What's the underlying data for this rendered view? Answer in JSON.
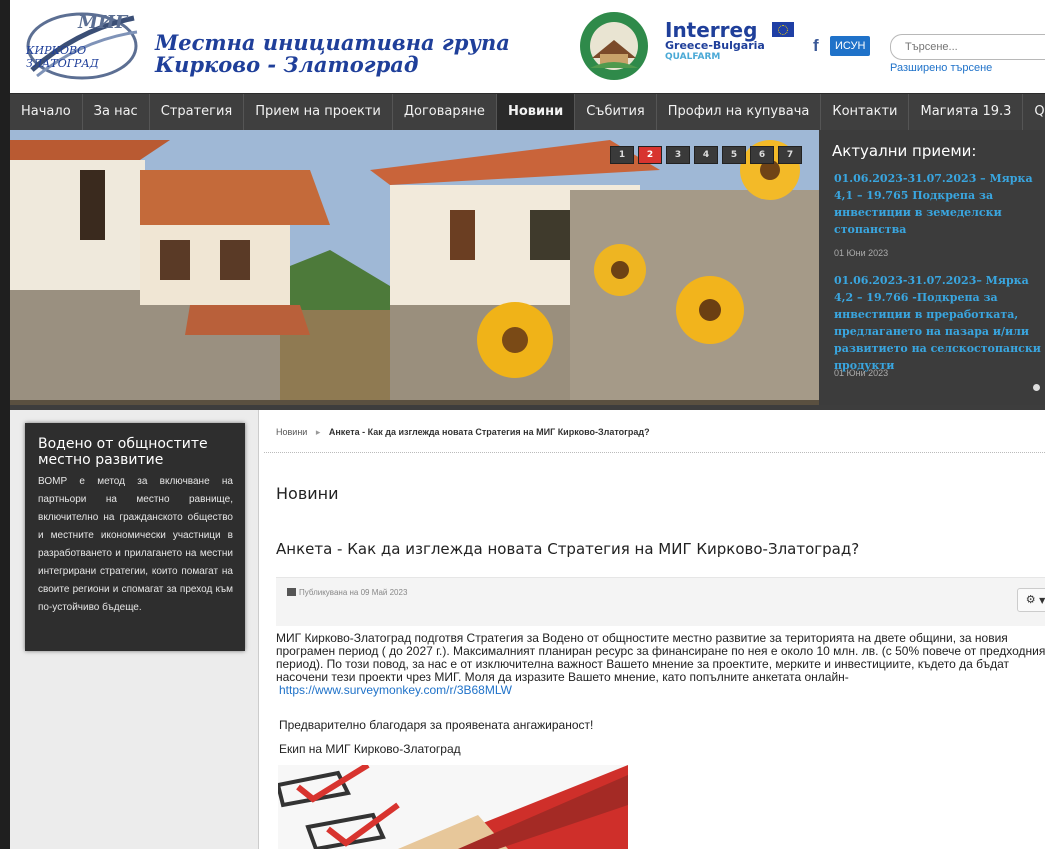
{
  "header": {
    "logo_text_top": "МИГ",
    "logo_text_line1": "КИРКОВО",
    "logo_text_line2": "ЗЛАТОГРАД",
    "site_title_line1": "Местна инициативна група",
    "site_title_line2": "Кирково - Златоград",
    "interreg_brand": "Interreg",
    "interreg_sub1": "Greece-Bulgaria",
    "interreg_sub2": "QUALFARM",
    "facebook_label": "f",
    "isun_label": "ИСУН",
    "search_placeholder": "Търсене...",
    "advanced_search": "Разширено търсене"
  },
  "nav": {
    "items": [
      {
        "label": "Начало"
      },
      {
        "label": "За нас"
      },
      {
        "label": "Стратегия"
      },
      {
        "label": "Прием на проекти"
      },
      {
        "label": "Договаряне"
      },
      {
        "label": "Новини"
      },
      {
        "label": "Събития"
      },
      {
        "label": "Профил на купувача"
      },
      {
        "label": "Контакти"
      },
      {
        "label": "Магията 19.3"
      },
      {
        "label": "QualFarm"
      }
    ],
    "active": "Новини"
  },
  "slider": {
    "pages": [
      "1",
      "2",
      "3",
      "4",
      "5",
      "6",
      "7"
    ],
    "active_page": "2"
  },
  "current_calls": {
    "title": "Актуални приеми:",
    "items": [
      {
        "text": "01.06.2023-31.07.2023 – Мярка 4,1 – 19.765 Подкрепа за инвестиции в земеделски стопанства",
        "date": "01 Юни 2023"
      },
      {
        "text": "01.06.2023-31.07.2023– Мярка 4,2 – 19.766 -Подкрепа за инвестиции в преработката, предлагането на пазара и/или развитието на селскостопански продукти",
        "date": "01 Юни 2023"
      }
    ]
  },
  "info_box": {
    "title": "Водено от общностите местно развитие",
    "text": "ВОМР е метод за включване на партньори на местно равнище, включително на гражданското общество и местните икономически участници в разработването и прилагането на местни интегрирани стратегии, които помагат на своите региони и спомагат за преход към по-устойчиво бъдеще."
  },
  "breadcrumb": {
    "home": "Новини",
    "current": "Анкета - Как да изглежда новата Стратегия на МИГ Кирково-Златоград?"
  },
  "page": {
    "title": "Новини",
    "article_title": "Анкета - Как да изглежда новата Стратегия на МИГ Кирково-Златоград?",
    "published": "Публикувана на 09 Май 2023",
    "body": "МИГ Кирково-Златоград подготвя Стратегия за Водено от общностите местно развитие за територията на двете общини, за новия програмен период ( до 2027 г.). Максималният планиран ресурс за финансиране по нея е около 10 млн. лв. (с 50% повече от предходния период). По този повод, за нас е от изключителна важност Вашето мнение за проектите, мерките и инвестициите, където да бъдат насочени тези проекти чрез МИГ.  Моля да изразите Вашето мнение, като попълните анкетата  онлайн-",
    "survey_link": "https://www.surveymonkey.com/r/3B68MLW",
    "thanks": "Предварително благодаря за проявената ангажираност!",
    "team": "Екип на МИГ Кирково-Златоград"
  },
  "colors": {
    "nav_bg": "#3f3f3f",
    "accent_blue": "#1f3f9a",
    "link_blue": "#39a6e0",
    "active_dot": "#d8342f"
  }
}
